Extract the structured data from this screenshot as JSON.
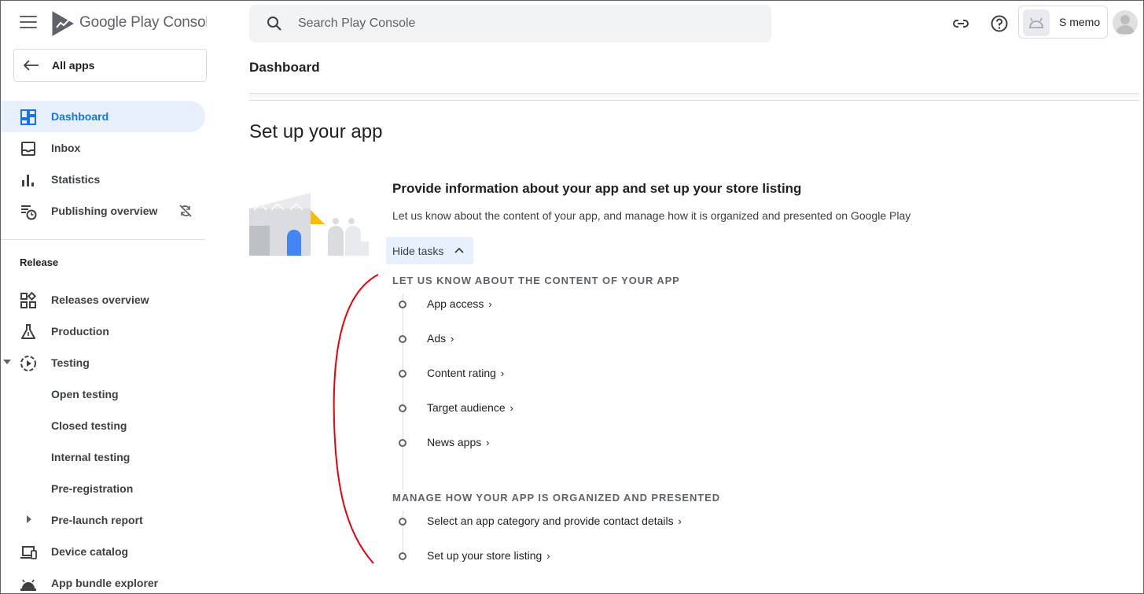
{
  "header": {
    "brand_google_play": "Google Play",
    "brand_console": "Console",
    "search_placeholder": "Search Play Console",
    "app_name": "S memo"
  },
  "sidebar": {
    "all_apps": "All apps",
    "items_top": [
      {
        "label": "Dashboard",
        "active": true,
        "icon": "dashboard-icon"
      },
      {
        "label": "Inbox",
        "icon": "inbox-icon"
      },
      {
        "label": "Statistics",
        "icon": "bar-chart-icon"
      },
      {
        "label": "Publishing overview",
        "icon": "publishing-schedule-icon",
        "tail_icon": "sync-disabled-icon"
      }
    ],
    "section_release": "Release",
    "items_release": [
      {
        "label": "Releases overview",
        "icon": "releases-grid-icon"
      },
      {
        "label": "Production",
        "icon": "flask-icon"
      },
      {
        "label": "Testing",
        "icon": "play-circle-dashed-icon",
        "expanded": true
      },
      {
        "label": "Open testing"
      },
      {
        "label": "Closed testing"
      },
      {
        "label": "Internal testing"
      },
      {
        "label": "Pre-registration"
      },
      {
        "label": "Pre-launch report",
        "collapsed": true
      },
      {
        "label": "Device catalog",
        "icon": "devices-icon"
      },
      {
        "label": "App bundle explorer",
        "icon": "android-icon"
      }
    ]
  },
  "main": {
    "page_title": "Dashboard",
    "setup_heading": "Set up your app",
    "card_title": "Provide information about your app and set up your store listing",
    "card_desc": "Let us know about the content of your app, and manage how it is organized and presented on Google Play",
    "hide_tasks": "Hide tasks",
    "group1_label": "LET US KNOW ABOUT THE CONTENT OF YOUR APP",
    "group1_tasks": [
      "App access",
      "Ads",
      "Content rating",
      "Target audience",
      "News apps"
    ],
    "group2_label": "MANAGE HOW YOUR APP IS ORGANIZED AND PRESENTED",
    "group2_tasks": [
      "Select an app category and provide contact details",
      "Set up your store listing"
    ],
    "chevron": "›"
  },
  "colors": {
    "accent": "#1a73e8",
    "active_bg": "#e8f0fe",
    "annotation": "#e8000b"
  }
}
